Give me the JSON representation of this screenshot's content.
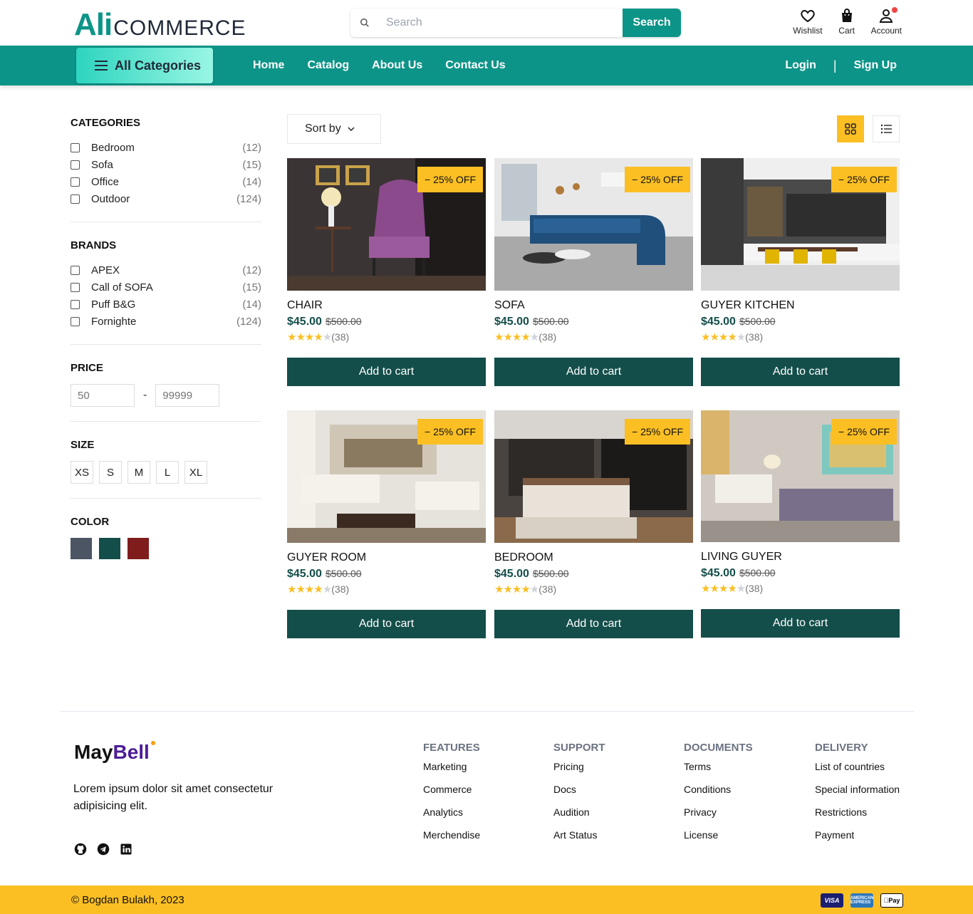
{
  "header": {
    "logo_part1": "Ali",
    "logo_part2": "COMMERCE",
    "search_placeholder": "Search",
    "search_button": "Search",
    "icons": [
      {
        "label": "Wishlist",
        "icon": "heart-icon"
      },
      {
        "label": "Cart",
        "icon": "bag-icon"
      },
      {
        "label": "Account",
        "icon": "user-icon"
      }
    ]
  },
  "nav": {
    "all_categories": "All Categories",
    "links": [
      "Home",
      "Catalog",
      "About Us",
      "Contact Us"
    ],
    "login": "Login",
    "separator": "|",
    "signup": "Sign Up"
  },
  "filters": {
    "categories_title": "CATEGORIES",
    "categories": [
      {
        "label": "Bedroom",
        "count": "(12)"
      },
      {
        "label": "Sofa",
        "count": "(15)"
      },
      {
        "label": "Office",
        "count": "(14)"
      },
      {
        "label": "Outdoor",
        "count": "(124)"
      }
    ],
    "brands_title": "BRANDS",
    "brands": [
      {
        "label": "APEX",
        "count": "(12)"
      },
      {
        "label": "Call of SOFA",
        "count": "(15)"
      },
      {
        "label": "Puff B&G",
        "count": "(14)"
      },
      {
        "label": "Fornighte",
        "count": "(124)"
      }
    ],
    "price_title": "PRICE",
    "price_min_placeholder": "50",
    "price_sep": "-",
    "price_max_placeholder": "99999",
    "size_title": "SIZE",
    "sizes": [
      "XS",
      "S",
      "M",
      "L",
      "XL"
    ],
    "color_title": "COLOR",
    "colors": [
      "#4b5563",
      "#134e4a",
      "#7f1d1d"
    ]
  },
  "toolbar": {
    "sort_label": "Sort by"
  },
  "products": [
    {
      "name": "CHAIR",
      "price": "$45.00",
      "old_price": "$500.00",
      "badge": "− 25% OFF",
      "reviews": "(38)",
      "rating": 4,
      "button": "Add to cart"
    },
    {
      "name": "SOFA",
      "price": "$45.00",
      "old_price": "$500.00",
      "badge": "− 25% OFF",
      "reviews": "(38)",
      "rating": 4,
      "button": "Add to cart"
    },
    {
      "name": "GUYER KITCHEN",
      "price": "$45.00",
      "old_price": "$500.00",
      "badge": "− 25% OFF",
      "reviews": "(38)",
      "rating": 4,
      "button": "Add to cart"
    },
    {
      "name": "GUYER ROOM",
      "price": "$45.00",
      "old_price": "$500.00",
      "badge": "− 25% OFF",
      "reviews": "(38)",
      "rating": 4,
      "button": "Add to cart"
    },
    {
      "name": "BEDROOM",
      "price": "$45.00",
      "old_price": "$500.00",
      "badge": "− 25% OFF",
      "reviews": "(38)",
      "rating": 4,
      "button": "Add to cart"
    },
    {
      "name": "LIVING GUYER",
      "price": "$45.00",
      "old_price": "$500.00",
      "badge": "− 25% OFF",
      "reviews": "(38)",
      "rating": 4,
      "button": "Add to cart"
    }
  ],
  "footer": {
    "logo_part1": "May",
    "logo_part2": "Bell",
    "description": "Lorem ipsum dolor sit amet consectetur adipisicing elit.",
    "social": [
      "github-icon",
      "telegram-icon",
      "linkedin-icon"
    ],
    "columns": [
      {
        "title": "FEATURES",
        "links": [
          "Marketing",
          "Commerce",
          "Analytics",
          "Merchendise"
        ]
      },
      {
        "title": "SUPPORT",
        "links": [
          "Pricing",
          "Docs",
          "Audition",
          "Art Status"
        ]
      },
      {
        "title": "DOCUMENTS",
        "links": [
          "Terms",
          "Conditions",
          "Privacy",
          "License"
        ]
      },
      {
        "title": "DELIVERY",
        "links": [
          "List of countries",
          "Special information",
          "Restrictions",
          "Payment"
        ]
      }
    ],
    "copyright": "© Bogdan Bulakh, 2023",
    "payments": {
      "visa": "VISA",
      "amex": "AMERICAN EXPRESS",
      "apay": "Pay"
    }
  }
}
